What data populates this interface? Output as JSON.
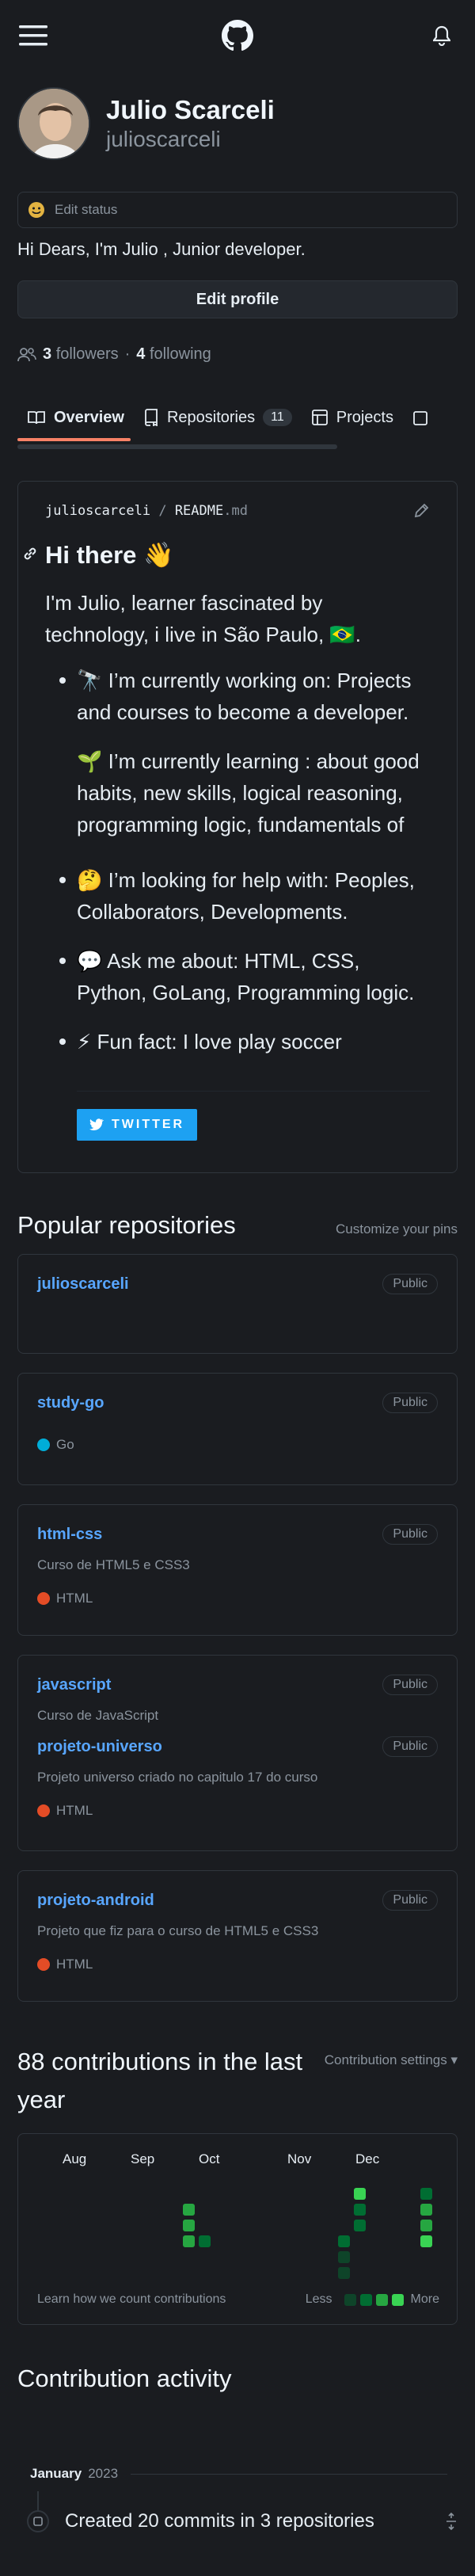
{
  "header": {
    "menu_icon": "hamburger-icon",
    "logo_icon": "github-logo",
    "bell_icon": "bell-icon"
  },
  "profile": {
    "name": "Julio Scarceli",
    "login": "julioscarceli",
    "status_label": "Edit status",
    "bio": "Hi Dears, I'm Julio , Junior developer.",
    "edit_profile": "Edit profile",
    "followers_count": "3",
    "followers_label": "followers",
    "separator": "·",
    "following_count": "4",
    "following_label": "following"
  },
  "tabs": [
    {
      "label": "Overview",
      "icon": "book-icon"
    },
    {
      "label": "Repositories",
      "icon": "repo-icon",
      "count": "11"
    },
    {
      "label": "Projects",
      "icon": "table-icon"
    }
  ],
  "readme": {
    "path_user": "julioscarceli",
    "path_sep": "/",
    "path_file": "README",
    "path_ext": ".md",
    "heading": "Hi there 👋",
    "intro": "I'm Julio, learner fascinated by technology, i live in São Paulo, 🇧🇷.",
    "items": [
      "🔭 I’m currently working on: Projects and courses to become a developer.",
      "🌱 I’m currently learning : about good habits, new skills, logical reasoning, programming logic, fundamentals of programming, English language.",
      "🤔 I’m looking for help with: Peoples, Collaborators, Developments.",
      "💬 Ask me about: HTML, CSS, Python, GoLang, Programming logic.",
      "⚡ Fun fact: I love play soccer"
    ],
    "twitter": "TWITTER"
  },
  "repos_section": {
    "title": "Popular repositories",
    "customize": "Customize your pins"
  },
  "repos": [
    {
      "name": "julioscarceli",
      "visibility": "Public"
    },
    {
      "name": "study-go",
      "visibility": "Public",
      "lang": "Go",
      "lang_color": "#00add8"
    },
    {
      "name": "html-css",
      "visibility": "Public",
      "desc": "Curso de HTML5 e CSS3",
      "lang": "HTML",
      "lang_color": "#e34c26"
    },
    {
      "name": "javascript",
      "visibility": "Public",
      "desc": "Curso de JavaScript"
    },
    {
      "name": "projeto-universo",
      "visibility": "Public",
      "desc": "Projeto universo criado no capitulo 17 do curso",
      "lang": "HTML",
      "lang_color": "#e34c26"
    },
    {
      "name": "projeto-android",
      "visibility": "Public",
      "desc": "Projeto que fiz para o curso de HTML5 e CSS3",
      "lang": "HTML",
      "lang_color": "#e34c26"
    }
  ],
  "contributions": {
    "title": "88 contributions in the last year",
    "settings": "Contribution settings ▾",
    "months": [
      "Aug",
      "Sep",
      "Oct",
      "Nov",
      "Dec"
    ],
    "learn": "Learn how we count contributions",
    "less": "Less",
    "more": "More",
    "colors": [
      "#0e4429",
      "#006d32",
      "#26a641",
      "#39d353"
    ]
  },
  "activity": {
    "title": "Contribution activity",
    "month": "January",
    "year": "2023",
    "summary": "Created 20 commits in 3 repositories"
  }
}
